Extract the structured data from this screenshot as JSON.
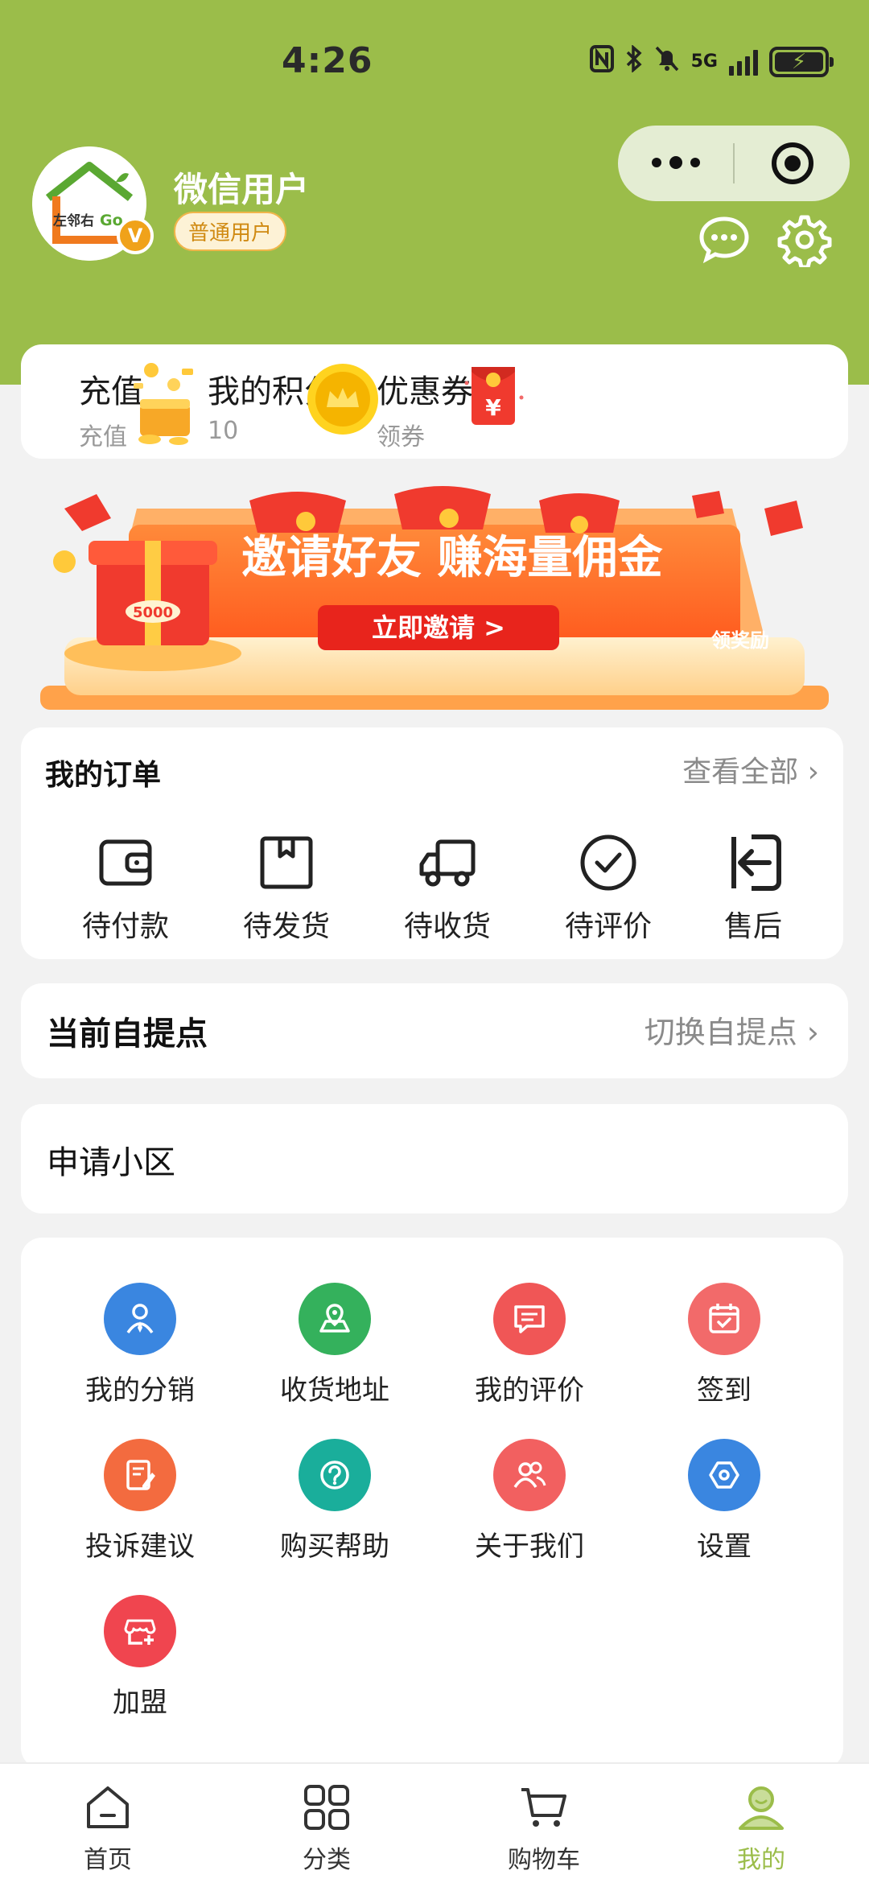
{
  "status_bar": {
    "time": "4:26",
    "network": "5G",
    "icons": [
      "nfc-icon",
      "bluetooth-icon",
      "bell-muted-icon",
      "signal-icon",
      "battery-charging-icon"
    ]
  },
  "user": {
    "name": "微信用户",
    "tag": "普通用户",
    "avatar_logo_text": "左邻右Go",
    "avatar_badge": "V"
  },
  "assets": [
    {
      "title": "充值",
      "sub": "充值",
      "icon": "coin-pile-icon"
    },
    {
      "title": "我的积分",
      "sub": "10",
      "icon": "crown-coin-icon"
    },
    {
      "title": "优惠券",
      "sub": "领券",
      "icon": "red-envelope-icon"
    }
  ],
  "banner": {
    "headline": "邀请好友 赚海量佣金",
    "button": "立即邀请 >",
    "corner": "领奖励",
    "gift_amount": "5000"
  },
  "orders": {
    "title": "我的订单",
    "view_all": "查看全部",
    "items": [
      {
        "label": "待付款",
        "icon": "wallet-icon"
      },
      {
        "label": "待发货",
        "icon": "package-icon"
      },
      {
        "label": "待收货",
        "icon": "truck-icon"
      },
      {
        "label": "待评价",
        "icon": "check-circle-icon"
      },
      {
        "label": "售后",
        "icon": "return-icon"
      }
    ]
  },
  "pickup": {
    "title": "当前自提点",
    "switch": "切换自提点"
  },
  "community": {
    "title": "申请小区"
  },
  "services": [
    {
      "label": "我的分销",
      "icon": "distributor-icon",
      "color": "#3a86e0"
    },
    {
      "label": "收货地址",
      "icon": "location-map-icon",
      "color": "#34b15c"
    },
    {
      "label": "我的评价",
      "icon": "comment-icon",
      "color": "#f05656"
    },
    {
      "label": "签到",
      "icon": "calendar-check-icon",
      "color": "#f26a6a"
    },
    {
      "label": "投诉建议",
      "icon": "edit-note-icon",
      "color": "#f36b3f"
    },
    {
      "label": "购买帮助",
      "icon": "help-icon",
      "color": "#1aae9b"
    },
    {
      "label": "关于我们",
      "icon": "people-icon",
      "color": "#f26060"
    },
    {
      "label": "设置",
      "icon": "settings-hex-icon",
      "color": "#3a86e0"
    },
    {
      "label": "加盟",
      "icon": "store-add-icon",
      "color": "#f0454f"
    }
  ],
  "tabbar": [
    {
      "label": "首页",
      "icon": "home-icon",
      "active": false
    },
    {
      "label": "分类",
      "icon": "grid-icon",
      "active": false
    },
    {
      "label": "购物车",
      "icon": "cart-icon",
      "active": false
    },
    {
      "label": "我的",
      "icon": "profile-icon",
      "active": true
    }
  ],
  "colors": {
    "brand_green": "#9bbd4a",
    "page_bg": "#f2f2f2",
    "text_gray": "#8a8a8a"
  }
}
